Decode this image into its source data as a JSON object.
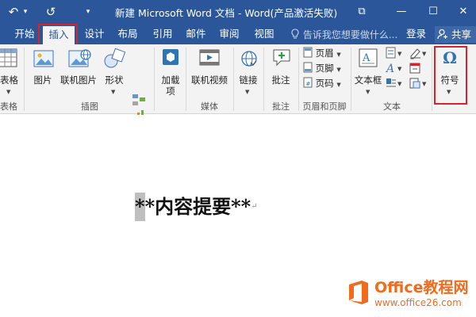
{
  "window": {
    "title": "新建 Microsoft Word 文档 - Word(产品激活失败)",
    "qat": {
      "undo": "↶",
      "redo": "↺",
      "more": "▾"
    },
    "controls": {
      "restore": "⧉",
      "minimize": "—",
      "maximize": "☐",
      "close": "✕"
    }
  },
  "tabs": [
    {
      "label": "开始",
      "active": false
    },
    {
      "label": "插入",
      "active": true
    },
    {
      "label": "设计",
      "active": false
    },
    {
      "label": "布局",
      "active": false
    },
    {
      "label": "引用",
      "active": false
    },
    {
      "label": "邮件",
      "active": false
    },
    {
      "label": "审阅",
      "active": false
    },
    {
      "label": "视图",
      "active": false
    }
  ],
  "tellme": {
    "icon": "lightbulb-icon",
    "placeholder": "告诉我您想要做什么..."
  },
  "account": {
    "login": "登录",
    "share": "共享",
    "share_icon": "person-icon"
  },
  "ribbon": {
    "groups": {
      "tables": "表格",
      "illustrations": "插图",
      "media": "媒体",
      "comments": "批注",
      "header_footer": "页眉和页脚",
      "text": "文本"
    },
    "buttons": {
      "table": "表格",
      "picture": "图片",
      "online_picture": "联机图片",
      "shapes": "形状",
      "addin_1": "加载",
      "addin_2": "项",
      "online_video": "联机视频",
      "link": "链接",
      "comment": "批注",
      "header": "页眉",
      "footer": "页脚",
      "page_number": "页码",
      "textbox": "文本框",
      "symbol": "符号"
    },
    "icons": {
      "symbol_glyph": "Ω",
      "addin_glyph": "⬢",
      "link_glyph": "🌐",
      "comment_glyph": "+",
      "textbox_glyph": "A"
    }
  },
  "document": {
    "cursor_text": "*",
    "content": "*内容提要**",
    "paragraph_mark": "↵"
  },
  "watermark": {
    "brand": "Office教程网",
    "url": "www.office26.com"
  },
  "colors": {
    "title_bar": "#2b579a",
    "ribbon_bg": "#f3f3f3",
    "highlight_box": "#d6242a",
    "watermark": "#f26b1d"
  }
}
